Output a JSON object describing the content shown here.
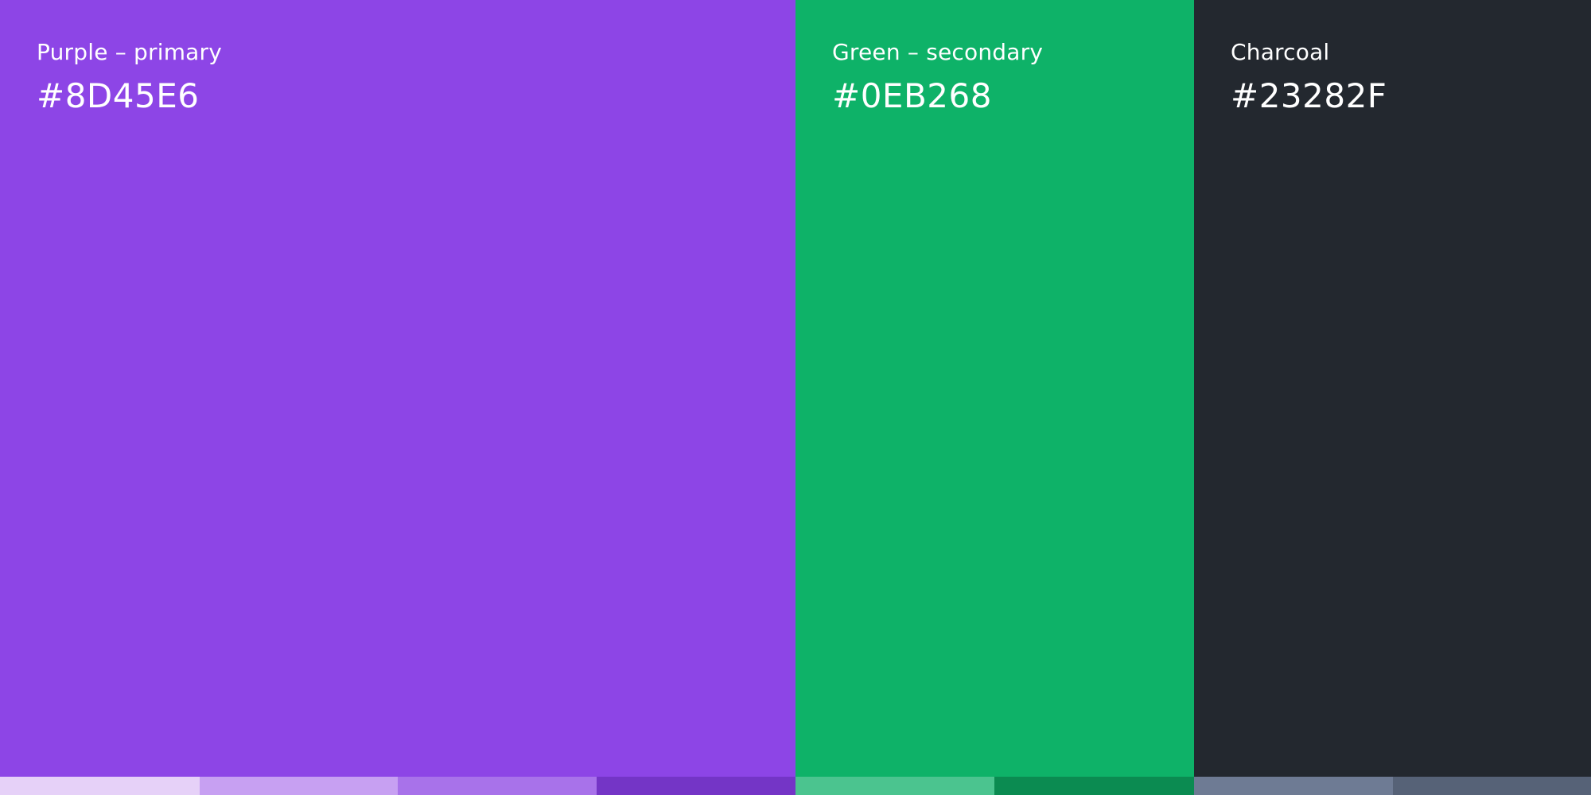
{
  "swatches": [
    {
      "label": "Purple – primary",
      "hex": "#8D45E6",
      "color": "#8D45E6"
    },
    {
      "label": "Green – secondary",
      "hex": "#0EB268",
      "color": "#0EB268"
    },
    {
      "label": "Charcoal",
      "hex": "#23282F",
      "color": "#23282F"
    }
  ],
  "tints": [
    {
      "color": "#E6D1F8"
    },
    {
      "color": "#C7A0F2"
    },
    {
      "color": "#A872EA"
    },
    {
      "color": "#7435C6"
    },
    {
      "color": "#4BC48F"
    },
    {
      "color": "#0B8B51"
    },
    {
      "color": "#6E7B94"
    },
    {
      "color": "#566277"
    }
  ]
}
